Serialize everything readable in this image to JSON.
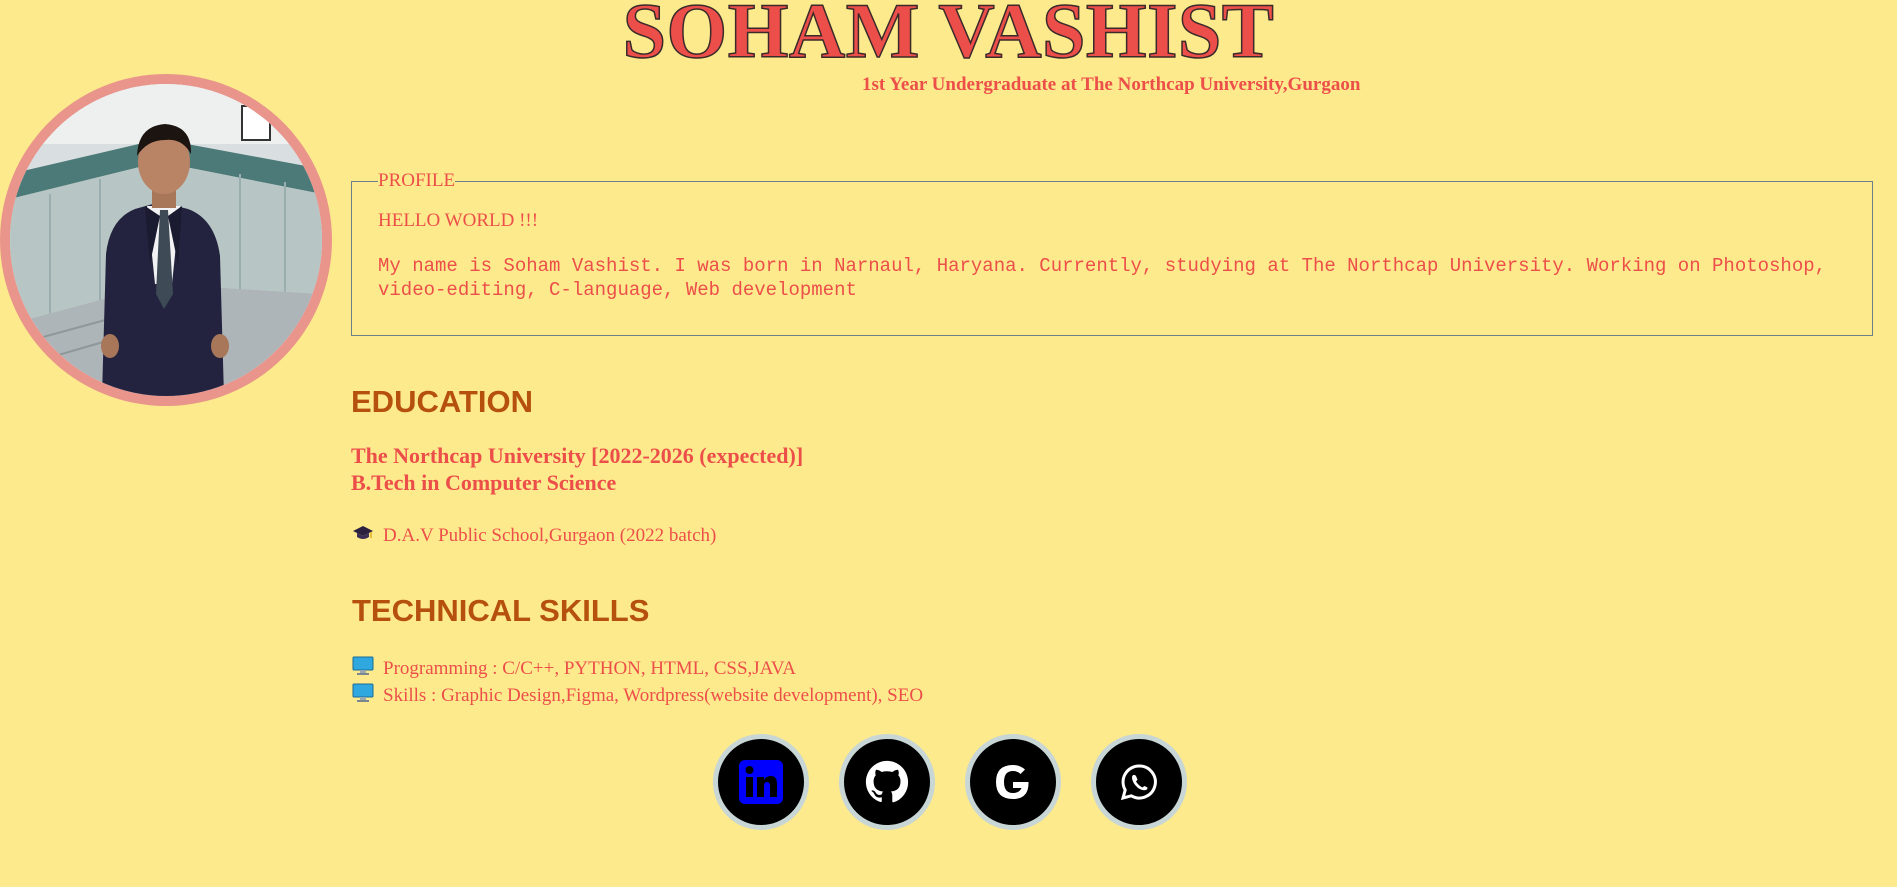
{
  "header": {
    "name": "SOHAM VASHIST",
    "subtitle": "1st Year Undergraduate at The Northcap University,Gurgaon"
  },
  "profile": {
    "legend": "PROFILE",
    "greeting": "HELLO WORLD !!!",
    "bio": "My name is Soham Vashist. I was born in Narnaul, Haryana. Currently, studying at The Northcap University. Working on Photoshop, video-editing, C-language, Web development"
  },
  "education": {
    "heading": "EDUCATION",
    "university": "The Northcap University [2022-2026 (expected)]",
    "degree": "B.Tech in Computer Science",
    "school_icon": "graduation-cap-icon",
    "school": "D.A.V Public School,Gurgaon (2022 batch)"
  },
  "skills": {
    "heading": "TECHNICAL SKILLS",
    "items": [
      {
        "icon": "computer-icon",
        "text": "Programming : C/C++, PYTHON, HTML, CSS,JAVA"
      },
      {
        "icon": "computer-icon",
        "text": "Skills : Graphic Design,Figma, Wordpress(website development), SEO"
      }
    ]
  },
  "social": [
    {
      "icon": "linkedin-icon"
    },
    {
      "icon": "github-icon"
    },
    {
      "icon": "google-icon"
    },
    {
      "icon": "whatsapp-icon"
    }
  ],
  "colors": {
    "background": "#fdea8c",
    "accent": "#ec4f4a",
    "heading": "#b5500d",
    "avatar_ring": "#e9958b",
    "linkedin": "#0000ff"
  }
}
